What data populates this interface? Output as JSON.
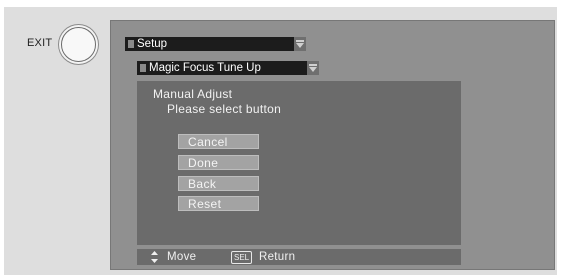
{
  "exit": {
    "label": "EXIT"
  },
  "menu": {
    "setup_label": "Setup",
    "submenu_label": "Magic Focus Tune Up"
  },
  "panel": {
    "title": "Manual Adjust",
    "subtitle": "Please select button",
    "options": [
      "Cancel",
      "Done",
      "Back",
      "Reset"
    ]
  },
  "footer": {
    "move_label": "Move",
    "sel_key": "SEL",
    "return_label": "Return"
  },
  "icons": {
    "exit_button": "circle-button-icon",
    "dropdown_arrow": "dropdown-arrow-icon",
    "move": "up-down-arrow-icon",
    "select": "sel-key-icon"
  },
  "colors": {
    "background": "#dedede",
    "screen": "#909090",
    "panel": "#6b6b6b",
    "dropdown": "#1c1c1c",
    "option": "#a3a3a3"
  }
}
